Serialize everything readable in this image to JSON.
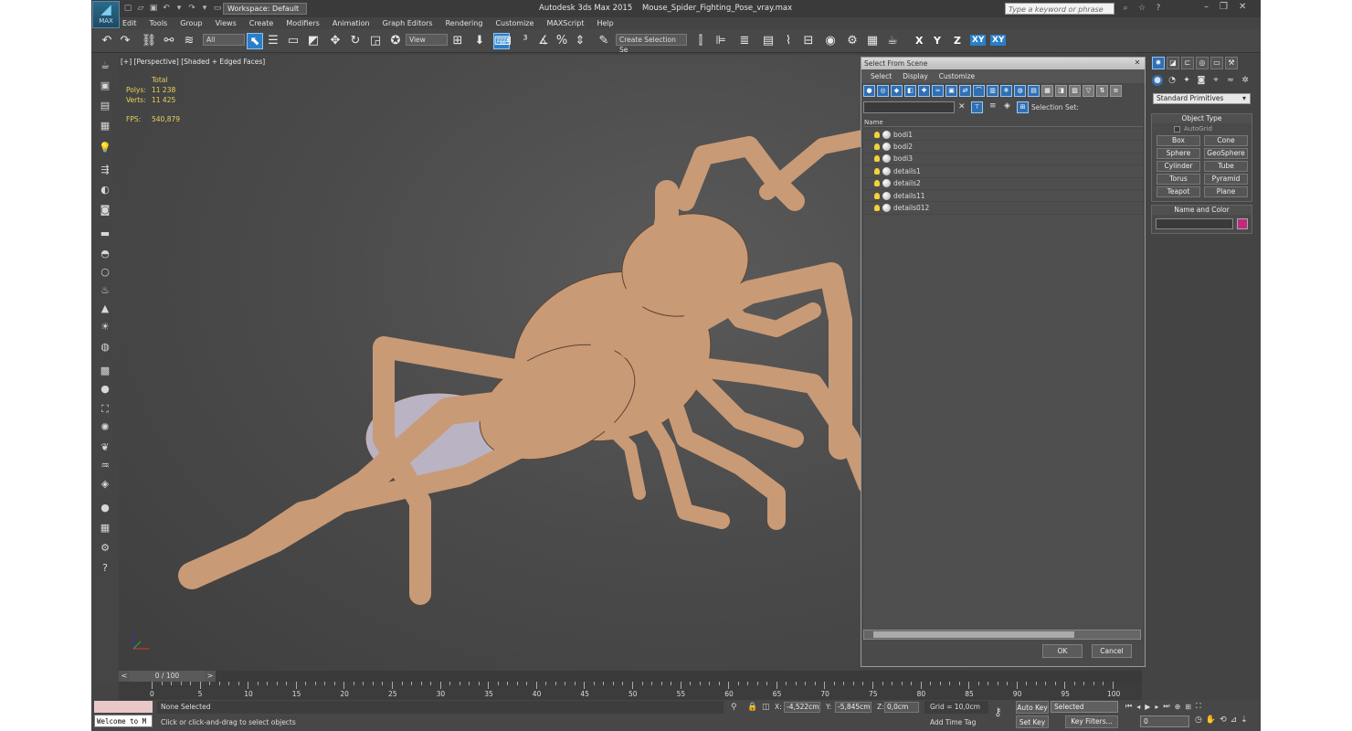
{
  "app": {
    "title": "Autodesk 3ds Max  2015",
    "file": "Mouse_Spider_Fighting_Pose_vray.max",
    "logo_text": "MAX",
    "workspace": "Workspace: Default",
    "search_placeholder": "Type a keyword or phrase"
  },
  "menu": [
    "Edit",
    "Tools",
    "Group",
    "Views",
    "Create",
    "Modifiers",
    "Animation",
    "Graph Editors",
    "Rendering",
    "Customize",
    "MAXScript",
    "Help"
  ],
  "toolbar": {
    "filter": "All",
    "refcoord": "View",
    "selset": "Create Selection Se",
    "axes": [
      "X",
      "Y",
      "Z",
      "XY",
      "XY"
    ]
  },
  "viewport": {
    "label": "[+] [Perspective] [Shaded + Edged Faces]",
    "stats": {
      "header": "Total",
      "polys_label": "Polys:",
      "polys": "11 238",
      "verts_label": "Verts:",
      "verts": "11 425",
      "fps_label": "FPS:",
      "fps": "540,879"
    },
    "model_color": "#c99a76",
    "wire_color": "#4b3a2f"
  },
  "dialog": {
    "title": "Select From Scene",
    "menus": [
      "Select",
      "Display",
      "Customize"
    ],
    "selection_set_label": "Selection Set:",
    "column_header": "Name",
    "items": [
      "bodi1",
      "bodi2",
      "bodi3",
      "details1",
      "details2",
      "details11",
      "details012"
    ],
    "ok": "OK",
    "cancel": "Cancel"
  },
  "command_panel": {
    "category": "Standard Primitives",
    "object_type_title": "Object Type",
    "autogrid": "AutoGrid",
    "objects": [
      "Box",
      "Cone",
      "Sphere",
      "GeoSphere",
      "Cylinder",
      "Tube",
      "Torus",
      "Pyramid",
      "Teapot",
      "Plane"
    ],
    "name_color_title": "Name and Color",
    "object_color": "#c02a7d"
  },
  "timeline": {
    "thumb": "0 / 100",
    "ticks": [
      "0",
      "5",
      "10",
      "15",
      "20",
      "25",
      "30",
      "35",
      "40",
      "45",
      "50",
      "55",
      "60",
      "65",
      "70",
      "75",
      "80",
      "85",
      "90",
      "95",
      "100"
    ]
  },
  "status": {
    "maxscript_text": "Welcome to M",
    "selection": "None Selected",
    "hint": "Click or click-and-drag to select objects",
    "x_label": "X:",
    "x": "-4,522cm",
    "y_label": "Y:",
    "y": "-5,845cm",
    "z_label": "Z:",
    "z": "0,0cm",
    "grid": "Grid = 10,0cm",
    "add_time_tag": "Add Time Tag",
    "auto_key": "Auto Key",
    "set_key": "Set Key",
    "key_mode": "Selected",
    "key_filters": "Key Filters...",
    "frame": "0"
  }
}
